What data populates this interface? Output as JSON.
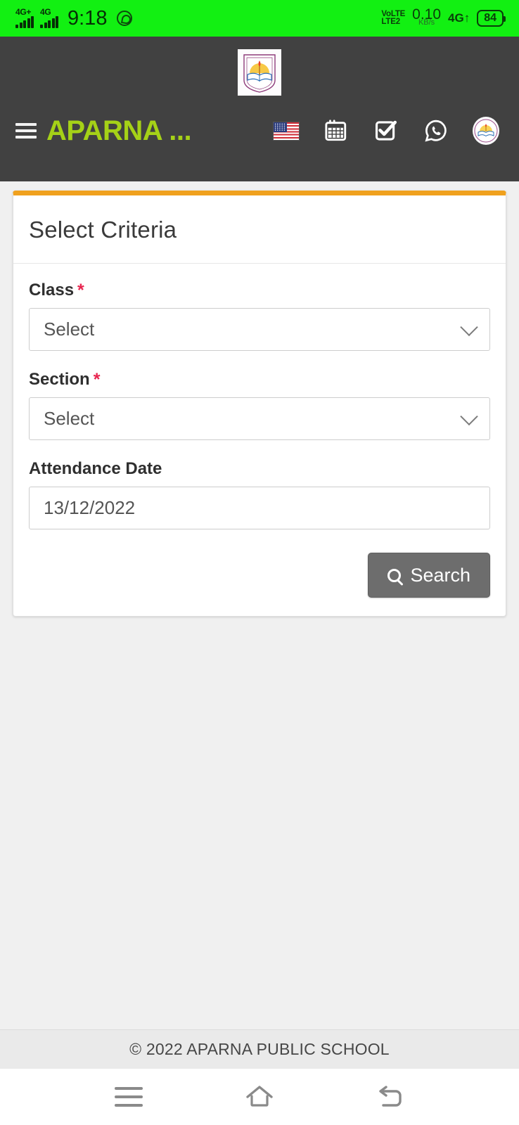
{
  "status_bar": {
    "network_1": "4G+",
    "network_2": "4G",
    "time": "9:18",
    "whatsapp_icon": "whatsapp-icon",
    "volte_line1": "VoLTE",
    "volte_line2": "LTE2",
    "data_speed": "0.10",
    "data_speed_unit": "KB/s",
    "network_right": "4G↑",
    "battery": "84",
    "background_color": "#12f012"
  },
  "header": {
    "logo_alt": "school-crest-logo",
    "menu_label": "menu",
    "brand": "APARNA ...",
    "brand_color": "#a5d117",
    "background_color": "#414141",
    "icons": [
      {
        "name": "flag-icon",
        "label": "English"
      },
      {
        "name": "calendar-icon",
        "label": "Calendar"
      },
      {
        "name": "checkbox-icon",
        "label": "Attendance"
      },
      {
        "name": "whatsapp-icon",
        "label": "WhatsApp"
      },
      {
        "name": "avatar-icon",
        "label": "Profile"
      }
    ]
  },
  "card": {
    "accent_color": "#f0a11e",
    "title": "Select Criteria",
    "fields": [
      {
        "label": "Class",
        "required": true,
        "value": "Select",
        "control": "dropdown"
      },
      {
        "label": "Section",
        "required": true,
        "value": "Select",
        "control": "dropdown"
      },
      {
        "label": "Attendance Date",
        "required": false,
        "value": "13/12/2022",
        "control": "date"
      }
    ],
    "required_marker": "*",
    "search_button": "Search"
  },
  "footer": {
    "copyright": "© 2022 APARNA PUBLIC SCHOOL"
  },
  "android_nav": {
    "recents": "recents-button",
    "home": "home-button",
    "back": "back-button"
  }
}
